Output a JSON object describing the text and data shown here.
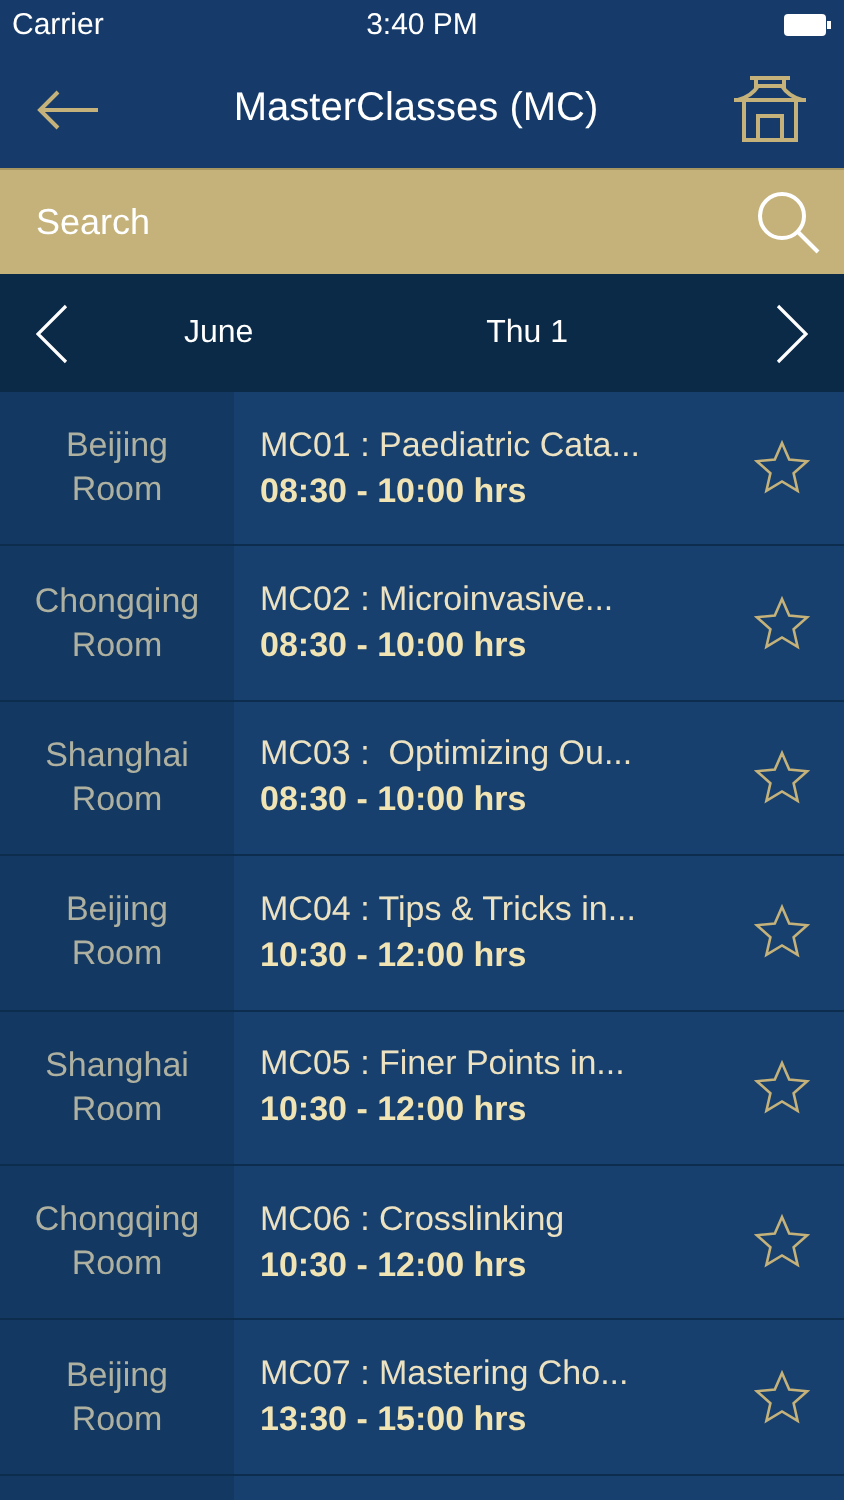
{
  "status_bar": {
    "carrier": "Carrier",
    "time": "3:40 PM"
  },
  "nav": {
    "title": "MasterClasses (MC)"
  },
  "search": {
    "placeholder": "Search"
  },
  "date_bar": {
    "month": "June",
    "day": "Thu 1"
  },
  "sessions": [
    {
      "room": "Beijing Room",
      "title": "MC01 : Paediatric Cata...",
      "time": "08:30 - 10:00 hrs",
      "favorite": false
    },
    {
      "room": "Chongqing Room",
      "title": "MC02 : Microinvasive...",
      "time": "08:30 - 10:00 hrs",
      "favorite": false
    },
    {
      "room": "Shanghai Room",
      "title": "MC03 :  Optimizing Ou...",
      "time": "08:30 - 10:00 hrs",
      "favorite": false
    },
    {
      "room": "Beijing Room",
      "title": "MC04 : Tips & Tricks in...",
      "time": "10:30 - 12:00 hrs",
      "favorite": false
    },
    {
      "room": "Shanghai Room",
      "title": "MC05 : Finer Points in...",
      "time": "10:30 - 12:00 hrs",
      "favorite": false
    },
    {
      "room": "Chongqing Room",
      "title": "MC06 : Crosslinking",
      "time": "10:30 - 12:00 hrs",
      "favorite": false
    },
    {
      "room": "Beijing Room",
      "title": "MC07 : Mastering Cho...",
      "time": "13:30 - 15:00 hrs",
      "favorite": false
    }
  ]
}
